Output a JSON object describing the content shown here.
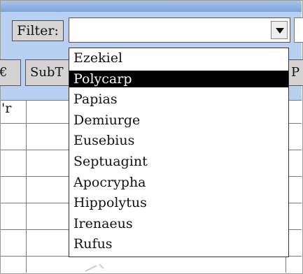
{
  "filter": {
    "label": "Filter:",
    "current_value": ""
  },
  "columns": {
    "left_partial": "€",
    "subtitle_partial": "SubT",
    "right_partial": "P"
  },
  "grid": {
    "first_row_partial": "'r"
  },
  "dropdown": {
    "selected_index": 1,
    "options": [
      "Ezekiel",
      "Polycarp",
      "Papias",
      "Demiurge",
      "Eusebius",
      "Septuagint",
      "Apocrypha",
      "Hippolytus",
      "Irenaeus",
      "Rufus"
    ]
  },
  "colors": {
    "toolbar_blue": "#b8d0f1",
    "selection_bg": "#000000"
  },
  "icons": {
    "dropdown_arrow": "chevron-down-icon",
    "ghost": "edit-icon"
  }
}
